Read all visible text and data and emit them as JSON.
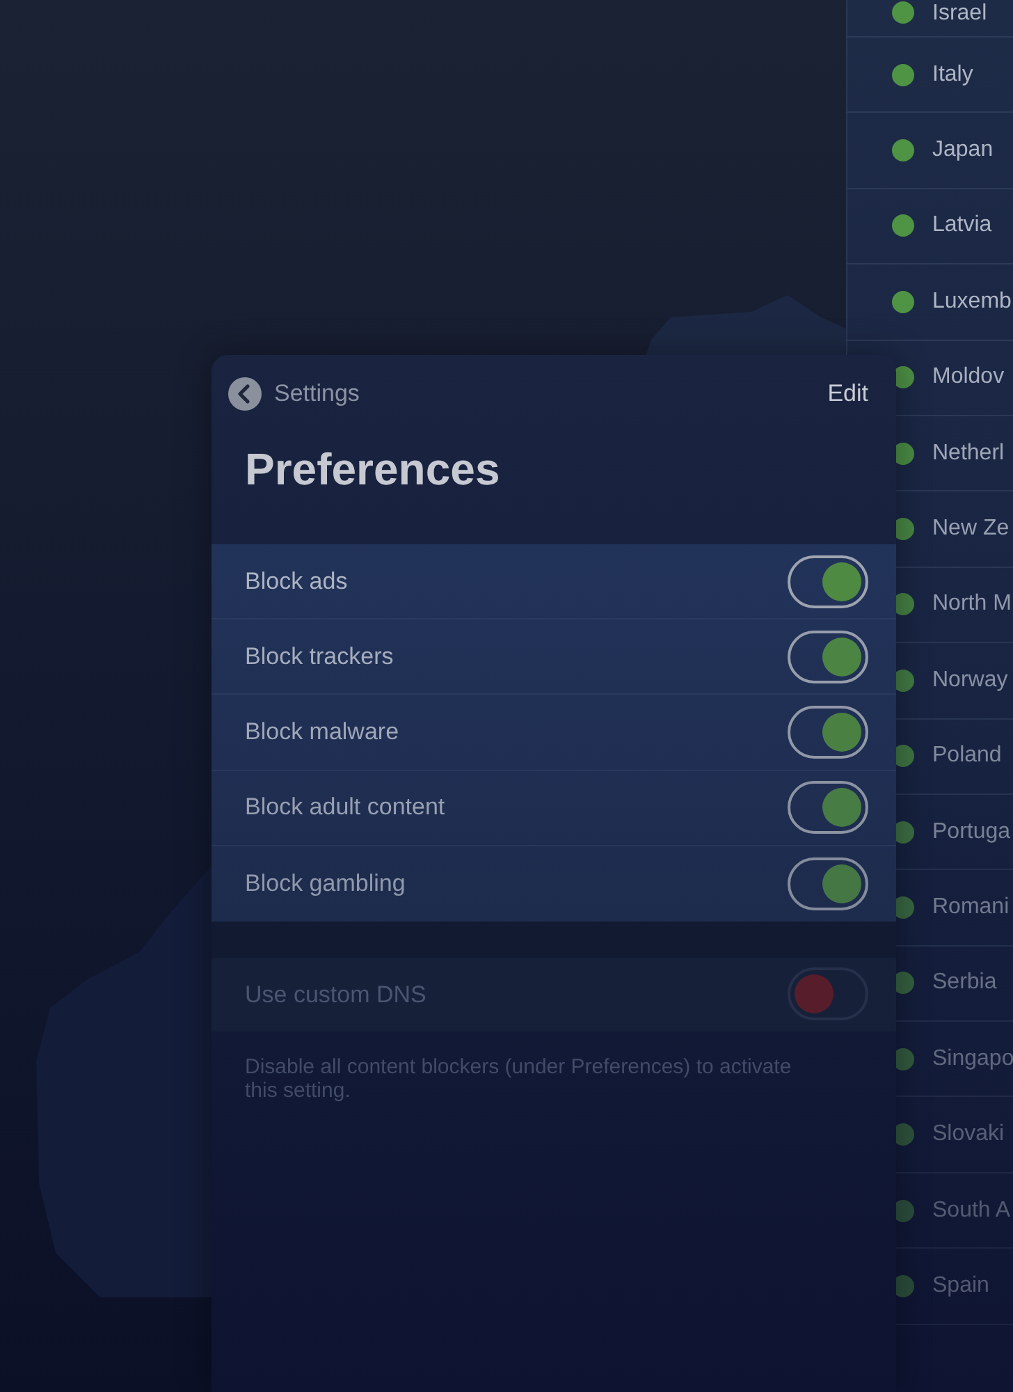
{
  "servers": [
    {
      "name": "Israel",
      "available": true
    },
    {
      "name": "Italy",
      "available": true
    },
    {
      "name": "Japan",
      "available": true
    },
    {
      "name": "Latvia",
      "available": true
    },
    {
      "name": "Luxemb",
      "available": true
    },
    {
      "name": "Moldov",
      "available": true
    },
    {
      "name": "Netherl",
      "available": true
    },
    {
      "name": "New Ze",
      "available": true
    },
    {
      "name": "North M",
      "available": true
    },
    {
      "name": "Norway",
      "available": true
    },
    {
      "name": "Poland",
      "available": true
    },
    {
      "name": "Portuga",
      "available": true
    },
    {
      "name": "Romani",
      "available": true
    },
    {
      "name": "Serbia",
      "available": true
    },
    {
      "name": "Singapo",
      "available": true
    },
    {
      "name": "Slovaki",
      "available": true
    },
    {
      "name": "South A",
      "available": true
    },
    {
      "name": "Spain",
      "available": true
    }
  ],
  "panel": {
    "back_label": "Settings",
    "edit_label": "Edit",
    "title": "Preferences"
  },
  "blockers": [
    {
      "label": "Block ads",
      "on": true
    },
    {
      "label": "Block trackers",
      "on": true
    },
    {
      "label": "Block malware",
      "on": true
    },
    {
      "label": "Block adult content",
      "on": true
    },
    {
      "label": "Block gambling",
      "on": true
    }
  ],
  "custom_dns": {
    "label": "Use custom DNS",
    "on": false,
    "disabled": true
  },
  "footnote": "Disable all content blockers (under Preferences) to activate this setting."
}
